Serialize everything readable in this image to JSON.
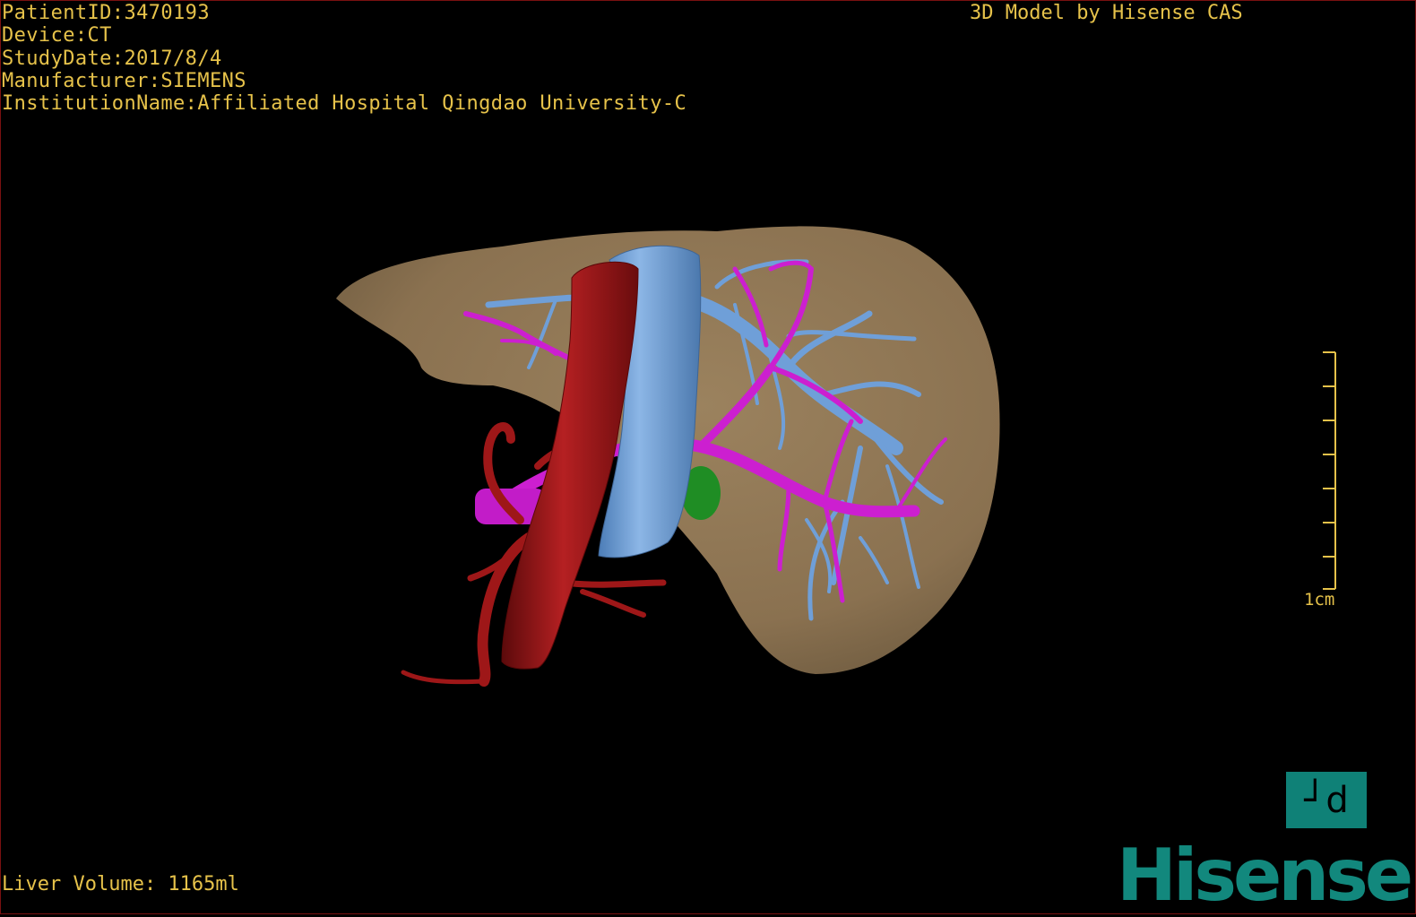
{
  "info": {
    "patient_id": "PatientID:3470193",
    "device": "Device:CT",
    "study_date": "StudyDate:2017/8/4",
    "manufacturer": "Manufacturer:SIEMENS",
    "institution": "InstitutionName:Affiliated Hospital Qingdao University-C"
  },
  "brand_caption": "3D Model by Hisense CAS",
  "liver_volume": "Liver Volume: 1165ml",
  "scale": {
    "label": "1cm",
    "ticks": 8
  },
  "orientation_button": {
    "label": "┘d",
    "icon": "orientation-icon"
  },
  "logo": {
    "text": "Hisense"
  },
  "colors": {
    "text": "#e6c24a",
    "liver": "#8d7553",
    "artery": "#9e1718",
    "ivc": "#6f9fd8",
    "portal_vein": "#cc1fd0",
    "hepatic_vein": "#6f9fd8",
    "tumor": "#1f8d24",
    "brand": "#12887d"
  }
}
